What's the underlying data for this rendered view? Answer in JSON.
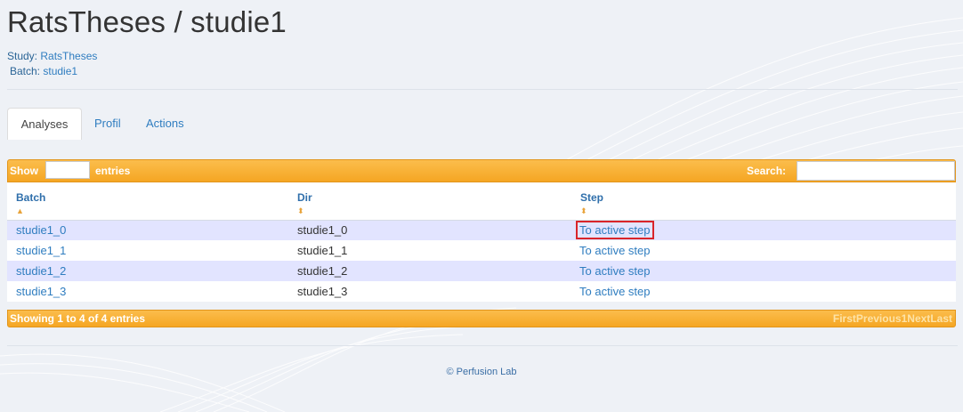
{
  "page": {
    "title": "RatsTheses / studie1"
  },
  "meta": {
    "study_label": "Study:",
    "study_value": "RatsTheses",
    "batch_label": "Batch:",
    "batch_value": "studie1"
  },
  "tabs": [
    {
      "label": "Analyses",
      "active": true
    },
    {
      "label": "Profil",
      "active": false
    },
    {
      "label": "Actions",
      "active": false
    }
  ],
  "table_header": {
    "show_label": "Show",
    "length_value": "",
    "entries_label": "entries",
    "search_label": "Search:",
    "search_value": ""
  },
  "columns": [
    {
      "label": "Batch",
      "sort_icon": "sort-asc-icon"
    },
    {
      "label": "Dir",
      "sort_icon": "sort-both-icon"
    },
    {
      "label": "Step",
      "sort_icon": "sort-both-icon"
    }
  ],
  "rows": [
    {
      "batch": "studie1_0",
      "dir": "studie1_0",
      "step": "To active step",
      "highlighted": true
    },
    {
      "batch": "studie1_1",
      "dir": "studie1_1",
      "step": "To active step",
      "highlighted": false
    },
    {
      "batch": "studie1_2",
      "dir": "studie1_2",
      "step": "To active step",
      "highlighted": false
    },
    {
      "batch": "studie1_3",
      "dir": "studie1_3",
      "step": "To active step",
      "highlighted": false
    }
  ],
  "table_footer": {
    "info": "Showing 1 to 4 of 4 entries",
    "pagination": {
      "first": "First",
      "previous": "Previous",
      "page": "1",
      "next": "Next",
      "last": "Last"
    }
  },
  "footer": {
    "copyright": "© Perfusion Lab"
  },
  "colors": {
    "accent_orange": "#f5a623",
    "link_blue": "#2f7dc0",
    "odd_row": "#e2e4ff",
    "highlight_red": "#d9252a"
  }
}
